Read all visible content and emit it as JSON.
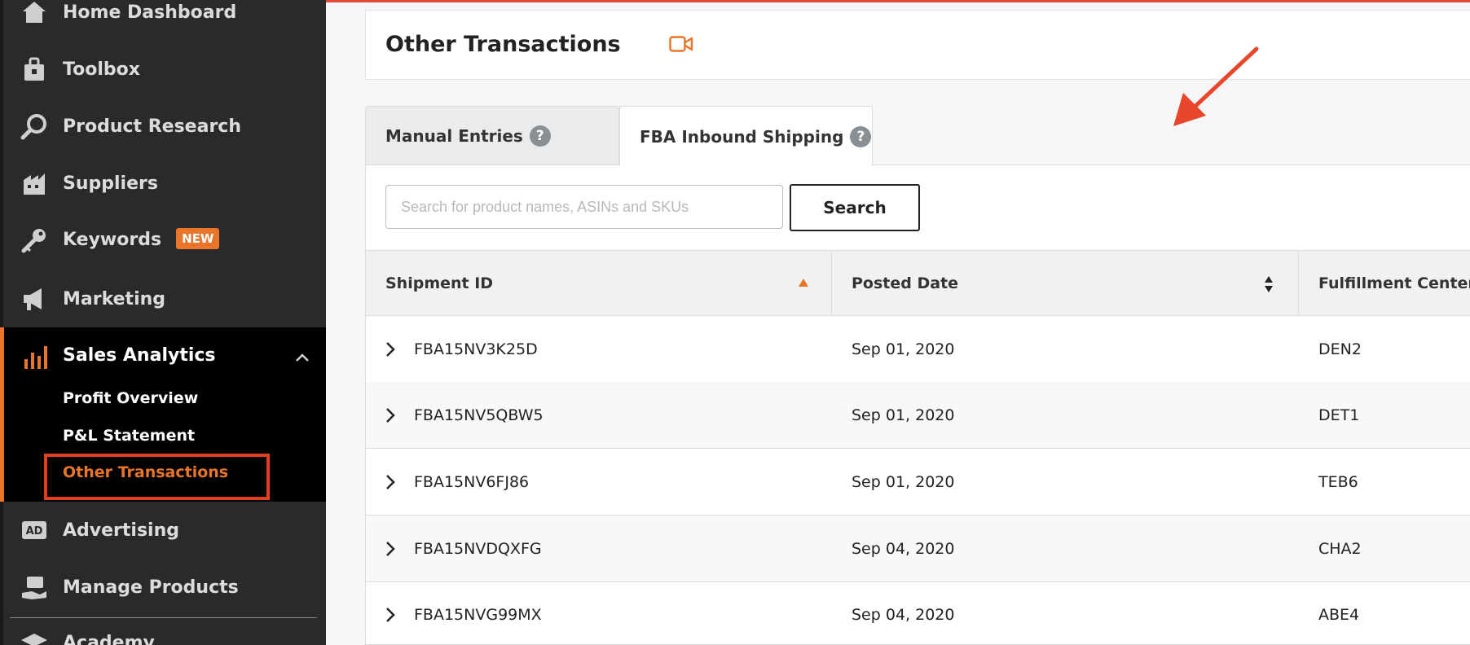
{
  "sidebar": {
    "items": [
      {
        "label": "Home Dashboard",
        "icon": "home-icon"
      },
      {
        "label": "Toolbox",
        "icon": "toolbox-icon"
      },
      {
        "label": "Product Research",
        "icon": "magnifier-icon"
      },
      {
        "label": "Suppliers",
        "icon": "building-icon"
      },
      {
        "label": "Keywords",
        "icon": "key-icon",
        "badge": "NEW"
      },
      {
        "label": "Marketing",
        "icon": "megaphone-icon"
      }
    ],
    "sales": {
      "label": "Sales Analytics",
      "icon": "bar-chart-icon",
      "subitems": [
        {
          "label": "Profit Overview"
        },
        {
          "label": "P&L Statement"
        },
        {
          "label": "Other Transactions"
        }
      ]
    },
    "after": [
      {
        "label": "Advertising",
        "icon": "ad-icon"
      },
      {
        "label": "Manage Products",
        "icon": "hand-box-icon"
      },
      {
        "label": "Academy",
        "icon": "graduation-cap-icon"
      }
    ]
  },
  "header": {
    "title": "Other Transactions",
    "video_icon": "video-camera-icon"
  },
  "tabs": [
    {
      "label": "Manual Entries"
    },
    {
      "label": "FBA Inbound Shipping"
    }
  ],
  "search": {
    "placeholder": "Search for product names, ASINs and SKUs",
    "button": "Search"
  },
  "table": {
    "columns": [
      "Shipment ID",
      "Posted Date",
      "Fulfillment Center"
    ],
    "rows": [
      {
        "id": "FBA15NV3K25D",
        "date": "Sep 01, 2020",
        "center": "DEN2"
      },
      {
        "id": "FBA15NV5QBW5",
        "date": "Sep 01, 2020",
        "center": "DET1"
      },
      {
        "id": "FBA15NV6FJ86",
        "date": "Sep 01, 2020",
        "center": "TEB6"
      },
      {
        "id": "FBA15NVDQXFG",
        "date": "Sep 04, 2020",
        "center": "CHA2"
      },
      {
        "id": "FBA15NVG99MX",
        "date": "Sep 04, 2020",
        "center": "ABE4"
      }
    ]
  },
  "colors": {
    "accent": "#e8752a",
    "highlight": "#e04020",
    "sidebar_bg": "#2a2a2a"
  }
}
